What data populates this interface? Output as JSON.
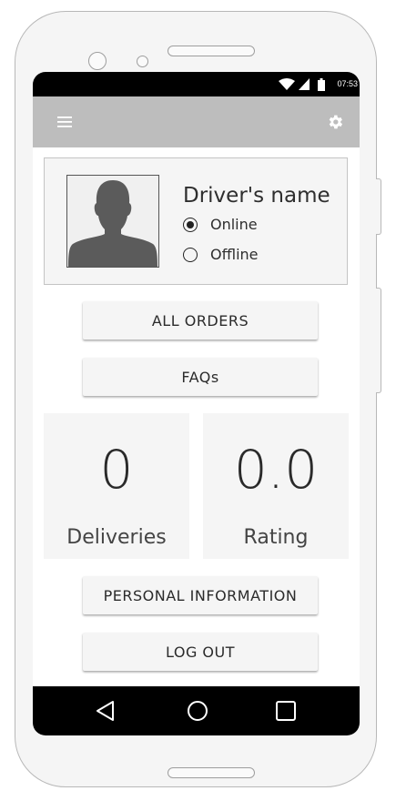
{
  "status_bar": {
    "time": "07:53"
  },
  "app_bar": {
    "menu_icon": "hamburger-menu-icon",
    "settings_icon": "gear-icon"
  },
  "profile": {
    "driver_name": "Driver's name",
    "status_options": [
      {
        "label": "Online",
        "selected": true
      },
      {
        "label": "Offline",
        "selected": false
      }
    ]
  },
  "buttons": {
    "all_orders": "ALL ORDERS",
    "faqs": "FAQs",
    "personal_information": "PERSONAL INFORMATION",
    "log_out": "LOG OUT"
  },
  "stats": {
    "deliveries": {
      "value": "0",
      "label": "Deliveries"
    },
    "rating": {
      "value": "0.0",
      "label": "Rating"
    }
  },
  "nav_bar": {
    "back_icon": "back-triangle-icon",
    "home_icon": "home-circle-icon",
    "recents_icon": "recents-square-icon"
  },
  "colors": {
    "app_bar": "#bdbdbd",
    "card_background": "#f5f5f5",
    "system_bars": "#000000",
    "text": "#2e2e2e"
  }
}
